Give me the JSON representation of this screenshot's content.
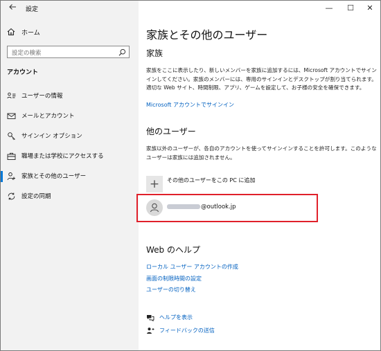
{
  "window": {
    "title": "設定",
    "back_icon": "back-arrow-icon",
    "controls": {
      "minimize": "—",
      "maximize": "☐",
      "close": "✕"
    }
  },
  "sidebar": {
    "home_label": "ホーム",
    "search_placeholder": "設定の検索",
    "section_label": "アカウント",
    "items": [
      {
        "label": "ユーザーの情報",
        "icon": "user-info-icon",
        "active": false
      },
      {
        "label": "メールとアカウント",
        "icon": "mail-icon",
        "active": false
      },
      {
        "label": "サインイン オプション",
        "icon": "key-icon",
        "active": false
      },
      {
        "label": "職場または学校にアクセスする",
        "icon": "briefcase-icon",
        "active": false
      },
      {
        "label": "家族とその他のユーザー",
        "icon": "family-user-icon",
        "active": true
      },
      {
        "label": "設定の同期",
        "icon": "sync-icon",
        "active": false
      }
    ]
  },
  "main": {
    "title": "家族とその他のユーザー",
    "family": {
      "heading": "家族",
      "description": "家族をここに表示したり、新しいメンバーを家族に追加するには、Microsoft アカウントでサインインしてください。家族のメンバーには、専用のサインインとデスクトップが割り当てられます。適切な Web サイト、時間制限、アプリ、ゲームを設定して、お子様の安全を確保できます。",
      "link": "Microsoft アカウントでサインイン"
    },
    "other_users": {
      "heading": "他のユーザー",
      "description": "家族以外のユーザーが、各自のアカウントを使ってサインインすることを許可します。このようなユーザーは家族には追加されません。",
      "add_label": "その他のユーザーをこの PC に追加",
      "add_icon": "plus-icon",
      "user": {
        "email_suffix": "@outlook.jp",
        "avatar_icon": "person-icon"
      }
    },
    "web_help": {
      "heading": "Web のヘルプ",
      "links": [
        "ローカル ユーザー アカウントの作成",
        "画面の制限時間の設定",
        "ユーザーの切り替え"
      ]
    },
    "footer": {
      "help_label": "ヘルプを表示",
      "feedback_label": "フィードバックの送信"
    }
  },
  "colors": {
    "accent": "#0078d7",
    "link": "#0060c0",
    "highlight": "#e0202a",
    "sidebar_bg": "#f2f2f2"
  }
}
